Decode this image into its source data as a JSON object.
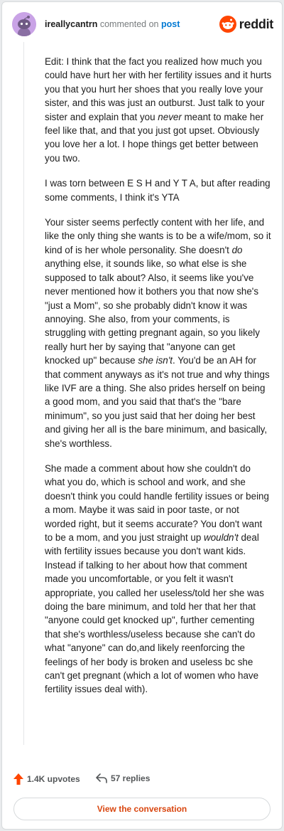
{
  "header": {
    "username": "ireallycantrn",
    "action_text": "commented on",
    "post_link": "post",
    "brand": "reddit"
  },
  "comment": {
    "paragraphs": [
      [
        "Edit: I think that the fact you realized how much you could have hurt her with her fertility issues and it hurts you that you hurt her shoes that you really love your sister, and this was just an outburst. Just talk to your sister and explain that you ",
        {
          "em": "never"
        },
        " meant to make her feel like that, and that you just got upset. Obviously you love her a lot. I hope things get better between you two."
      ],
      [
        "I was torn between E S H and Y T A, but after reading some comments, I think it's YTA"
      ],
      [
        "Your sister seems perfectly content with her life, and like the only thing she wants is to be a wife/mom, so it kind of is her whole personality. She doesn't ",
        {
          "em": "do"
        },
        " anything else, it sounds like, so what else is she supposed to talk about? Also, it seems like you've never mentioned how it bothers you that now she's \"just a Mom\", so she probably didn't know it was annoying. She also, from your comments, is struggling with getting pregnant again, so you likely really hurt her by saying that \"anyone can get knocked up\" because ",
        {
          "em": "she isn't"
        },
        ". You'd be an AH for that comment anyways as it's not true and why things like IVF are a thing. She also prides herself on being a good mom, and you said that that's the \"bare minimum\", so you just said that her doing her best and giving her all is the bare minimum, and basically, she's worthless."
      ],
      [
        "She made a comment about how she couldn't do what you do, which is school and work, and she doesn't think you could handle fertility issues or being a mom. Maybe it was said in poor taste, or not worded right, but it seems accurate? You don't want to be a mom, and you just straight up ",
        {
          "em": "wouldn't"
        },
        " deal with fertility issues because you don't want kids. Instead if talking to her about how that comment made you uncomfortable, or you felt it wasn't appropriate, you called her useless/told her she was doing the bare minimum, and told her that her that \"anyone could get knocked up\", further cementing that she's worthless/useless because she can't do what \"anyone\" can do,and likely reenforcing the feelings of her body is broken and useless bc she can't get pregnant (which a lot of women who have fertility issues deal with)."
      ]
    ]
  },
  "footer": {
    "upvotes": "1.4K upvotes",
    "replies": "57 replies",
    "view_button": "View the conversation"
  },
  "colors": {
    "accent": "#ff4500",
    "link": "#0079d3",
    "view_button_text": "#d9460f"
  },
  "icons": {
    "avatar": "snoo-avatar-icon",
    "brand": "reddit-logo-icon",
    "upvote": "upvote-arrow-icon",
    "reply": "reply-arrow-icon"
  }
}
